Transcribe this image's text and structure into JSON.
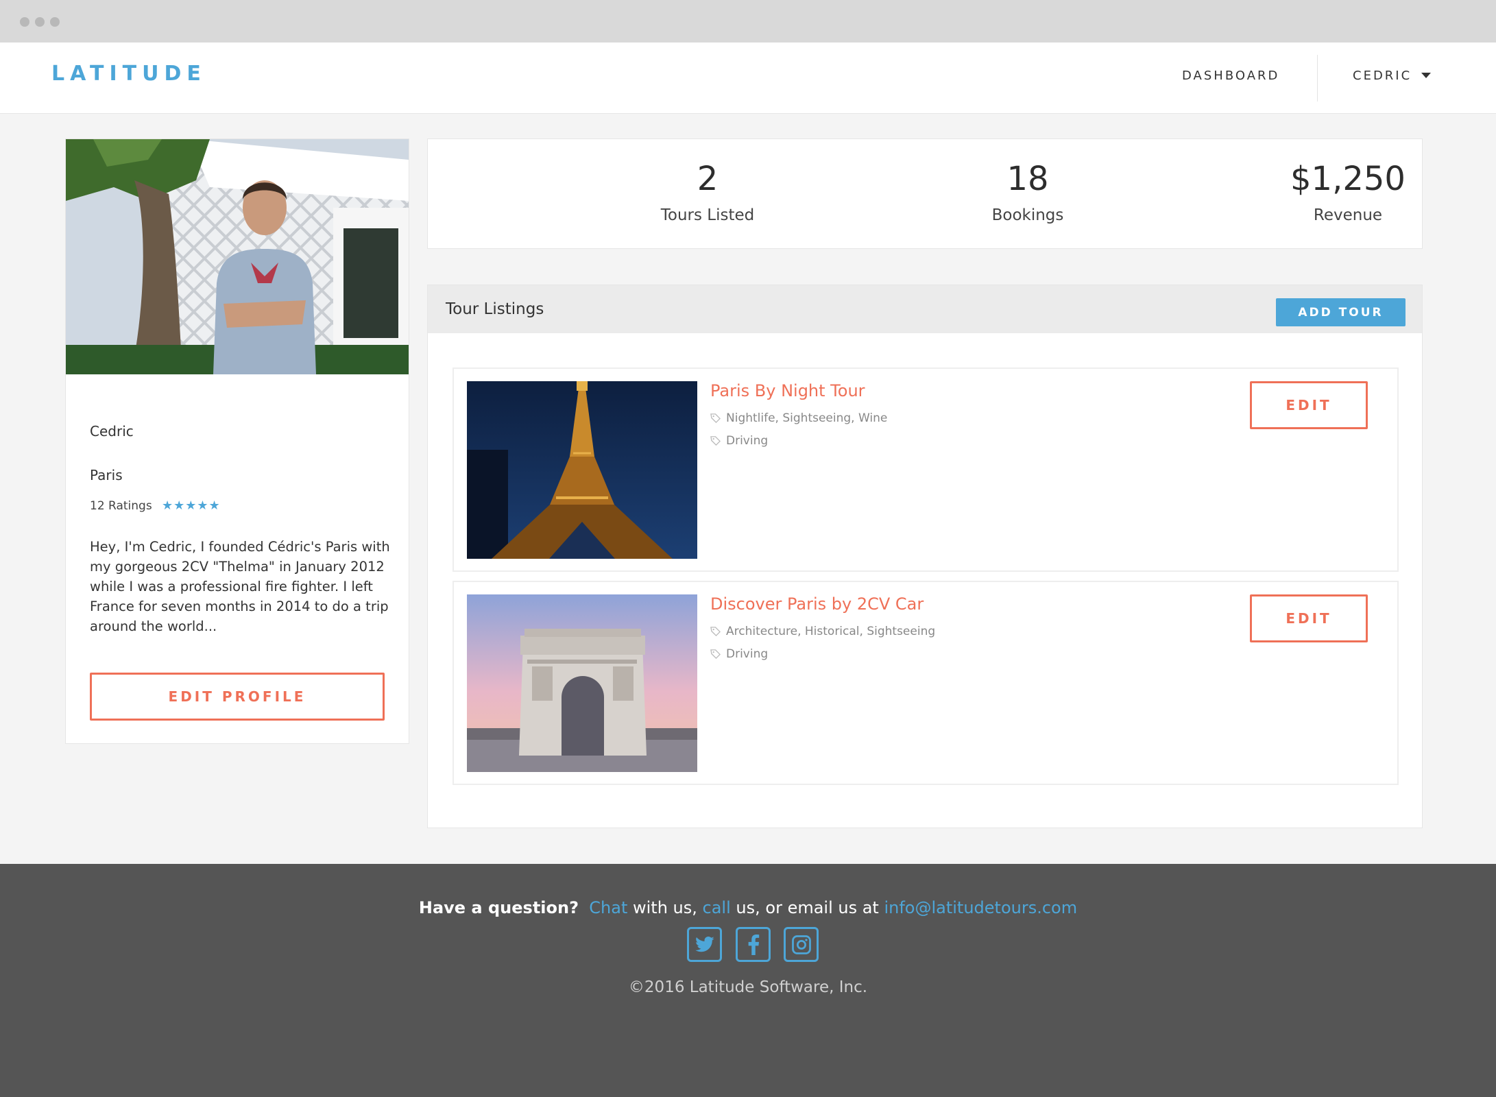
{
  "brand": {
    "logo": "LATITUDE",
    "accent": "#4da6d8",
    "highlight": "#ef7057"
  },
  "nav": {
    "dashboard": "DASHBOARD",
    "user": "CEDRIC"
  },
  "profile": {
    "name": "Cedric",
    "city": "Paris",
    "ratings": "12 Ratings",
    "stars": "★★★★★",
    "rating_value": 5,
    "bio": "Hey, I'm Cedric, I founded Cédric's Paris with my gorgeous 2CV \"Thelma\" in January 2012 while I was a professional fire fighter. I left France for seven months in 2014 to do a trip around the world...",
    "edit_label": "EDIT PROFILE"
  },
  "stats": [
    {
      "value": "2",
      "label": "Tours Listed"
    },
    {
      "value": "18",
      "label": "Bookings"
    },
    {
      "value": "$1,250",
      "label": "Revenue"
    }
  ],
  "tours": {
    "title": "Tour Listings",
    "add_label": "ADD TOUR",
    "items": [
      {
        "name": "Paris By Night Tour",
        "tags": "Nightlife, Sightseeing, Wine",
        "transport": "Driving",
        "edit_label": "EDIT"
      },
      {
        "name": "Discover Paris by 2CV Car",
        "tags": "Architecture, Historical, Sightseeing",
        "transport": "Driving",
        "edit_label": "EDIT"
      }
    ]
  },
  "footer": {
    "question": "Have a question?",
    "chat": "Chat",
    "text1": " with us, ",
    "call": "call",
    "text2": " us, or email us at ",
    "email": "info@latitudetours.com",
    "copyright": "©2016 Latitude Software, Inc.",
    "social_icons": [
      "twitter-icon",
      "facebook-icon",
      "instagram-icon"
    ]
  }
}
